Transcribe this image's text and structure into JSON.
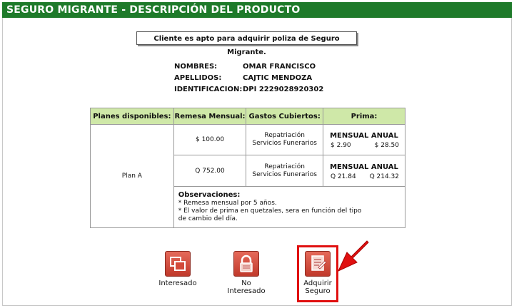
{
  "header": {
    "title": "SEGURO MIGRANTE - DESCRIPCIÓN DEL PRODUCTO"
  },
  "notice": "Cliente es apto para adquirir poliza de Seguro Migrante.",
  "client": {
    "nombres_label": "NOMBRES:",
    "nombres": "OMAR FRANCISCO",
    "apellidos_label": "APELLIDOS:",
    "apellidos": "CAJTIC MENDOZA",
    "id_label": "IDENTIFICACION:",
    "id": "DPI 2229028920302"
  },
  "table": {
    "headers": [
      "Planes disponibles:",
      "Remesa Mensual:",
      "Gastos Cubiertos:",
      "Prima:"
    ],
    "plan": "Plan A",
    "rows": [
      {
        "remesa": "$ 100.00",
        "gastos_1": "Repatriación",
        "gastos_2": "Servicios Funerarios",
        "prima_head": "MENSUAL ANUAL",
        "mensual": "$ 2.90",
        "anual": "$ 28.50"
      },
      {
        "remesa": "Q 752.00",
        "gastos_1": "Repatriación",
        "gastos_2": "Servicios Funerarios",
        "prima_head": "MENSUAL ANUAL",
        "mensual": "Q 21.84",
        "anual": "Q 214.32"
      }
    ],
    "obs_title": "Observaciones:",
    "obs_1": "* Remesa mensual por 5 años.",
    "obs_2": "* El valor de prima en quetzales, sera en función del tipo",
    "obs_3": "de cambio del día."
  },
  "actions": {
    "interesado": "Interesado",
    "no_interesado_1": "No",
    "no_interesado_2": "Interesado",
    "adquirir_1": "Adquirir",
    "adquirir_2": "Seguro"
  },
  "colors": {
    "header": "#1e7a2a",
    "table_head": "#cfe8a8",
    "icon": "#c0392b",
    "highlight": "#e01010"
  }
}
